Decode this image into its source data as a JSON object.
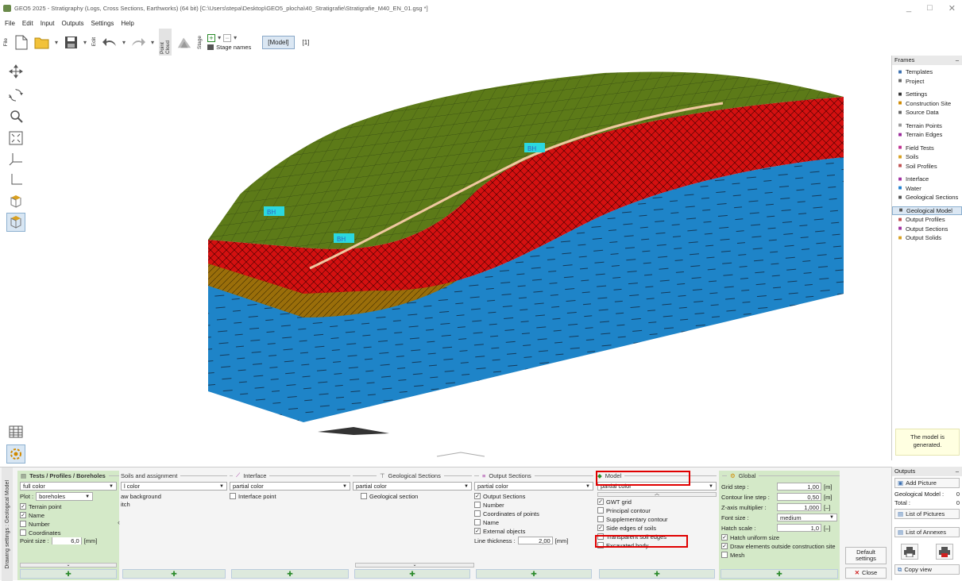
{
  "window": {
    "title": "GEO5 2025 - Stratigraphy (Logs, Cross Sections, Earthworks) (64 bit) [C:\\Users\\stepa\\Desktop\\GEO5_plocha\\40_Stratigrafie\\Stratigrafie_M40_EN_01.gsg *]",
    "controls": [
      "_",
      "□",
      "✕"
    ]
  },
  "menu": [
    "File",
    "Edit",
    "Input",
    "Outputs",
    "Settings",
    "Help"
  ],
  "toolbar": {
    "file_label": "File",
    "edit_label": "Edit",
    "point_cloud_label": "Point Cloud",
    "stage_label": "Stage",
    "stage_names": "Stage names",
    "model_button": "[Model]",
    "stage_index": "[1]"
  },
  "model_labels": [
    "BH",
    "BH",
    "BH"
  ],
  "frames": {
    "header": "Frames",
    "items": [
      {
        "label": "Templates",
        "icon": "templates-icon",
        "color": "#3a6fb0"
      },
      {
        "label": "Project",
        "icon": "project-icon",
        "color": "#666"
      },
      {
        "gap": true
      },
      {
        "label": "Settings",
        "icon": "gear-icon",
        "color": "#333"
      },
      {
        "label": "Construction Site",
        "icon": "site-icon",
        "color": "#d08a00"
      },
      {
        "label": "Source Data",
        "icon": "source-icon",
        "color": "#666"
      },
      {
        "gap": true
      },
      {
        "label": "Terrain Points",
        "icon": "points-icon",
        "color": "#999"
      },
      {
        "label": "Terrain Edges",
        "icon": "edges-icon",
        "color": "#9a2a9a"
      },
      {
        "gap": true
      },
      {
        "label": "Field Tests",
        "icon": "field-tests-icon",
        "color": "#c03090"
      },
      {
        "label": "Soils",
        "icon": "soils-icon",
        "color": "#d8a020"
      },
      {
        "label": "Soil Profiles",
        "icon": "soil-profiles-icon",
        "color": "#c05050"
      },
      {
        "gap": true
      },
      {
        "label": "Interface",
        "icon": "interface-icon",
        "color": "#a030a0"
      },
      {
        "label": "Water",
        "icon": "water-icon",
        "color": "#2080d0"
      },
      {
        "label": "Geological Sections",
        "icon": "sections-icon",
        "color": "#555"
      },
      {
        "gap": true
      },
      {
        "label": "Geological Model",
        "icon": "model-icon",
        "color": "#555",
        "selected": true
      },
      {
        "label": "Output Profiles",
        "icon": "output-profiles-icon",
        "color": "#c05050"
      },
      {
        "label": "Output Sections",
        "icon": "output-sections-icon",
        "color": "#a030a0"
      },
      {
        "label": "Output Solids",
        "icon": "output-solids-icon",
        "color": "#d8a020"
      }
    ],
    "message": "The model is generated."
  },
  "outputs": {
    "header": "Outputs",
    "add_picture": "Add Picture",
    "geo_model_label": "Geological Model :",
    "geo_model_value": "0",
    "total_label": "Total :",
    "total_value": "0",
    "list_pictures": "List of Pictures",
    "list_annexes": "List of Annexes",
    "copy_view": "Copy view"
  },
  "drawing_settings": {
    "side_label": "Drawing settings : Geological Model",
    "tests": {
      "header": "Tests / Profiles / Boreholes",
      "color": "full color",
      "plot_label": "Plot :",
      "plot_value": "boreholes",
      "checks": [
        {
          "label": "Terrain point",
          "checked": true
        },
        {
          "label": "Name",
          "checked": true
        },
        {
          "label": "Number",
          "checked": false
        },
        {
          "label": "Coordinates",
          "checked": false
        }
      ],
      "point_size_label": "Point size :",
      "point_size_value": "6,0",
      "point_size_unit": "[mm]"
    },
    "soils": {
      "header": "Soils and assignment",
      "color": "l color",
      "lines": [
        "aw background",
        "itch"
      ]
    },
    "interface": {
      "header": "Interface",
      "color": "partial color",
      "checks": [
        {
          "label": "Interface point",
          "checked": false
        }
      ]
    },
    "geo_sections": {
      "header": "Geological Sections",
      "color": "partial color",
      "checks": [
        {
          "label": "Geological section",
          "checked": false
        }
      ]
    },
    "output_sections": {
      "header": "Output Sections",
      "color": "partial color",
      "checks": [
        {
          "label": "Output Sections",
          "checked": true
        },
        {
          "label": "Number",
          "checked": false
        },
        {
          "label": "Coordinates of points",
          "checked": false
        },
        {
          "label": "Name",
          "checked": false
        },
        {
          "label": "External objects",
          "checked": true
        }
      ],
      "thickness_label": "Line thickness :",
      "thickness_value": "2,00",
      "thickness_unit": "[mm]"
    },
    "model": {
      "header": "Model",
      "color": "partial color",
      "checks": [
        {
          "label": "GWT grid",
          "checked": true
        },
        {
          "label": "Principal contour",
          "checked": false
        },
        {
          "label": "Supplementary contour",
          "checked": false
        },
        {
          "label": "Side edges of soils",
          "checked": true
        },
        {
          "label": "Transparent soil edges",
          "checked": false
        },
        {
          "label": "Excavated body",
          "checked": false
        }
      ]
    },
    "global": {
      "header": "Global",
      "rows": [
        {
          "label": "Grid step :",
          "value": "1,00",
          "unit": "[m]"
        },
        {
          "label": "Contour line step :",
          "value": "0,50",
          "unit": "[m]"
        },
        {
          "label": "Z-axis multiplier :",
          "value": "1,000",
          "unit": "[–]"
        }
      ],
      "font_label": "Font size :",
      "font_value": "medium",
      "hatch_label": "Hatch scale :",
      "hatch_value": "1,0",
      "hatch_unit": "[–]",
      "checks": [
        {
          "label": "Hatch uniform size",
          "checked": true
        },
        {
          "label": "Draw elements outside construction site",
          "checked": true
        },
        {
          "label": "Mesh",
          "checked": false
        }
      ]
    },
    "default_settings": "Default settings",
    "close": "Close"
  }
}
